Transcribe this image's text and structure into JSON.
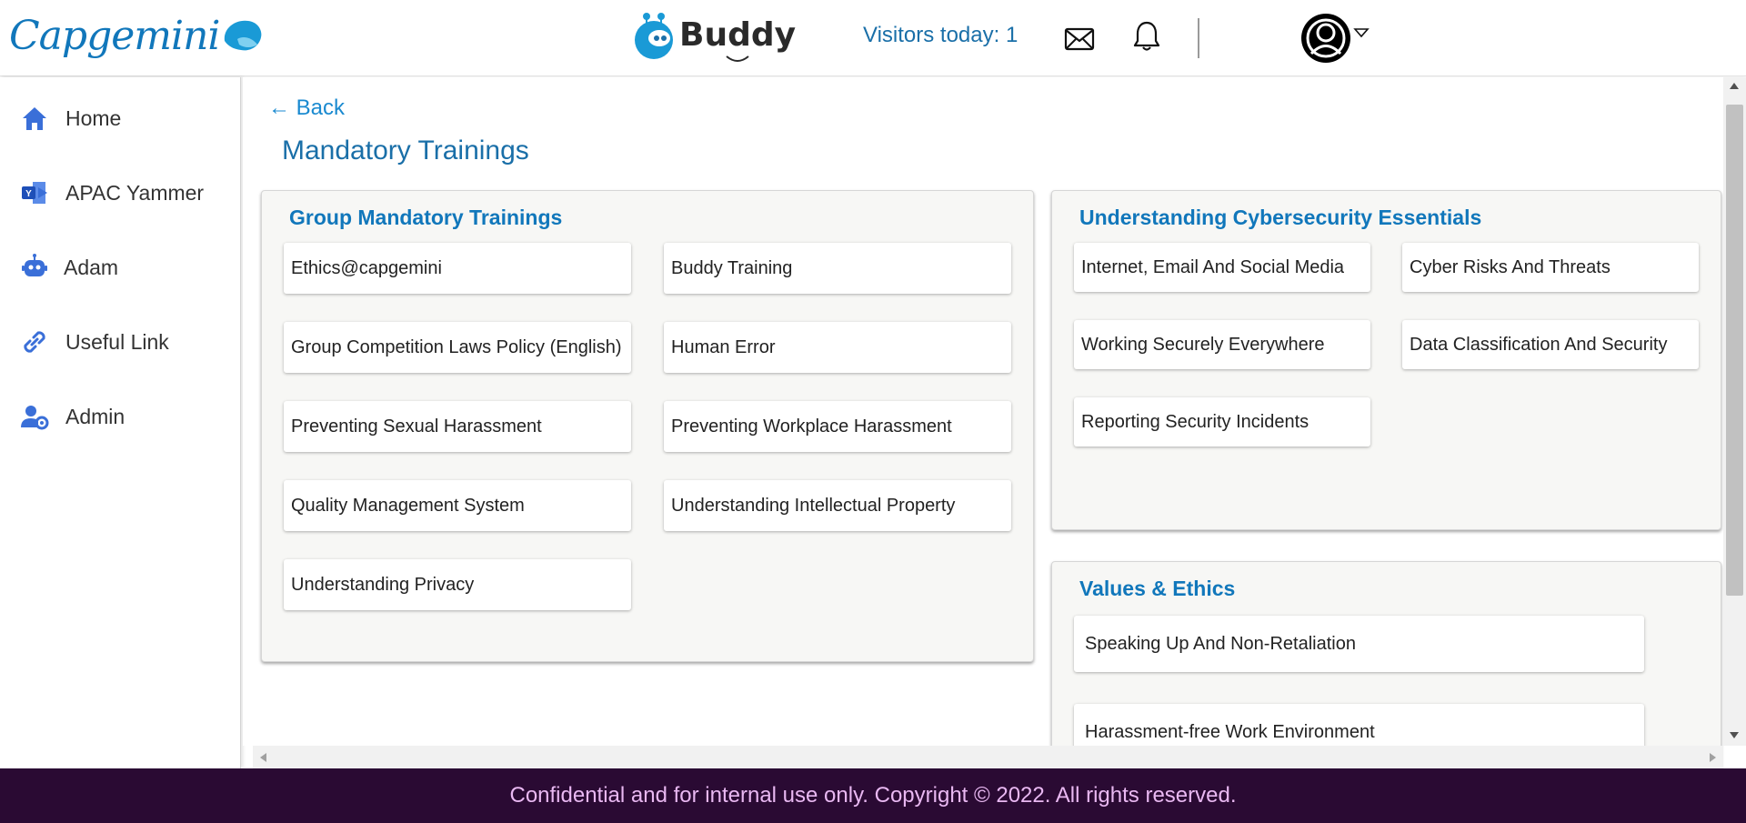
{
  "header": {
    "brand": "Capgemini",
    "app_name": "Buddy",
    "visitors": "Visitors today: 1"
  },
  "sidebar": {
    "items": [
      {
        "label": "Home",
        "icon": "home-icon"
      },
      {
        "label": "APAC Yammer",
        "icon": "yammer-icon"
      },
      {
        "label": "Adam",
        "icon": "robot-icon"
      },
      {
        "label": "Useful Link",
        "icon": "link-icon"
      },
      {
        "label": "Admin",
        "icon": "admin-gear-icon"
      }
    ]
  },
  "main": {
    "back_label": "← Back",
    "page_title": "Mandatory Trainings",
    "panels": [
      {
        "title": "Group Mandatory Trainings",
        "items": [
          "Ethics@capgemini",
          "Buddy Training",
          "Group Competition Laws Policy (English)",
          "Human Error",
          "Preventing Sexual Harassment",
          "Preventing Workplace Harassment",
          "Quality Management System",
          "Understanding Intellectual Property",
          "Understanding Privacy"
        ]
      },
      {
        "title": "Understanding Cybersecurity Essentials",
        "items": [
          "Internet, Email And Social Media",
          "Cyber Risks And Threats",
          "Working Securely Everywhere",
          "Data Classification And Security",
          "Reporting Security Incidents"
        ]
      },
      {
        "title": "Values & Ethics",
        "items": [
          "Speaking Up And Non-Retaliation",
          "Harassment-free Work Environment"
        ]
      }
    ]
  },
  "footer": {
    "text": "Confidential and for internal use only. Copyright © 2022. All rights reserved."
  },
  "colors": {
    "brand_blue": "#1177bb",
    "title_blue": "#1a6fa8",
    "link_blue": "#1a8ad0",
    "footer_bg": "#2a0a33",
    "footer_text": "#e9b8f2",
    "panel_bg": "#f7f7f5"
  }
}
